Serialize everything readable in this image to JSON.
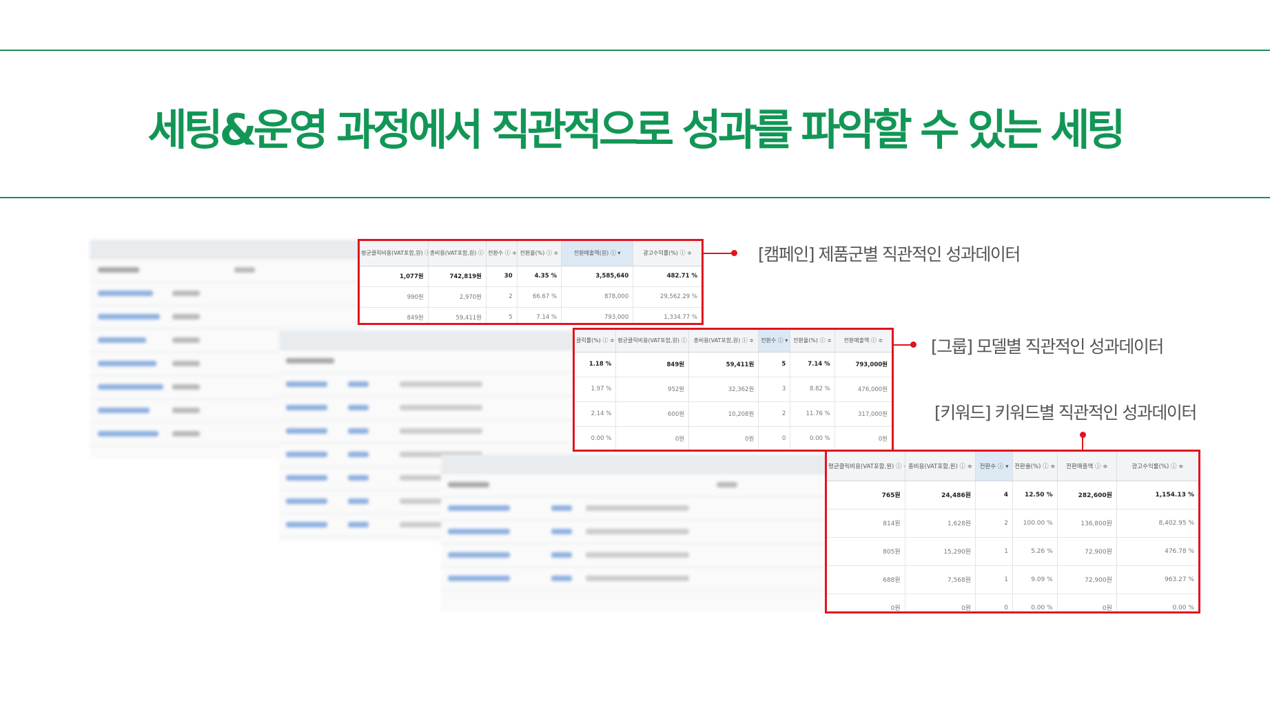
{
  "headline": "세팅&운영 과정에서 직관적으로 성과를 파악할 수 있는 세팅",
  "callouts": {
    "campaign": "[캠페인] 제품군별 직관적인 성과데이터",
    "group": "[그룹] 모델별 직관적인 성과데이터",
    "keyword": "[키워드] 키워드별 직관적인 성과데이터"
  },
  "colors": {
    "accent_green": "#129656",
    "highlight_red": "#e0141e"
  },
  "campaign_table": {
    "headers": [
      "평균클릭비용(VAT포함,원) ⓘ ≑",
      "총비용(VAT포함,원) ⓘ ≑",
      "전환수 ⓘ ≑",
      "전환율(%) ⓘ ≑",
      "전환매출액(원) ⓘ ▾",
      "광고수익률(%) ⓘ ≑"
    ],
    "total": [
      "1,077원",
      "742,819원",
      "30",
      "4.35 %",
      "3,585,640",
      "482.71 %"
    ],
    "rows": [
      [
        "990원",
        "2,970원",
        "2",
        "66.67 %",
        "878,000",
        "29,562.29 %"
      ],
      [
        "849원",
        "59,411원",
        "5",
        "7.14 %",
        "793,000",
        "1,334.77 %"
      ]
    ]
  },
  "group_table": {
    "headers": [
      "클릭률(%) ⓘ ≑",
      "평균클릭비용(VAT포함,원) ⓘ ≑",
      "총비용(VAT포함,원) ⓘ ≑",
      "전환수 ⓘ ▾",
      "전환율(%) ⓘ ≑",
      "전환매출액 ⓘ ≑"
    ],
    "total": [
      "1.18 %",
      "849원",
      "59,411원",
      "5",
      "7.14 %",
      "793,000원"
    ],
    "rows": [
      [
        "1.97 %",
        "952원",
        "32,362원",
        "3",
        "8.82 %",
        "476,000원"
      ],
      [
        "2.14 %",
        "600원",
        "10,208원",
        "2",
        "11.76 %",
        "317,000원"
      ],
      [
        "0.00 %",
        "0원",
        "0원",
        "0",
        "0.00 %",
        "0원"
      ]
    ]
  },
  "keyword_table": {
    "headers": [
      "평균클릭비용(VAT포함,원) ⓘ ≑",
      "총비용(VAT포함,원) ⓘ ≑",
      "전환수 ⓘ ▾",
      "전환율(%) ⓘ ≑",
      "전환매출액 ⓘ ≑",
      "광고수익률(%) ⓘ ≑"
    ],
    "total": [
      "765원",
      "24,486원",
      "4",
      "12.50 %",
      "282,600원",
      "1,154.13 %"
    ],
    "rows": [
      [
        "814원",
        "1,628원",
        "2",
        "100.00 %",
        "136,800원",
        "8,402.95 %"
      ],
      [
        "805원",
        "15,290원",
        "1",
        "5.26 %",
        "72,900원",
        "476.78 %"
      ],
      [
        "688원",
        "7,568원",
        "1",
        "9.09 %",
        "72,900원",
        "963.27 %"
      ],
      [
        "0원",
        "0원",
        "0",
        "0.00 %",
        "0원",
        "0.00 %"
      ]
    ]
  }
}
